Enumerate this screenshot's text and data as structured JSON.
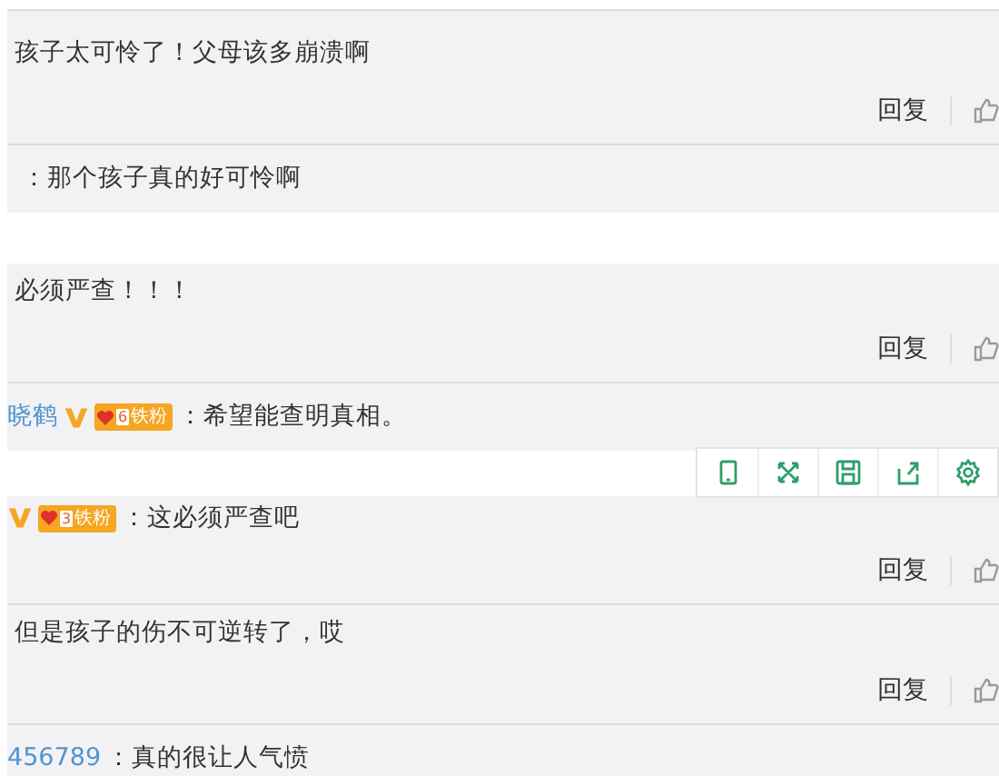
{
  "panels": [
    {
      "rows": [
        {
          "kind": "comment",
          "text": "孩子太可怜了！父母该多崩溃啊"
        },
        {
          "kind": "actions",
          "reply": "回复"
        },
        {
          "kind": "subcomment",
          "text": "：那个孩子真的好可怜啊"
        }
      ]
    },
    {
      "rows": [
        {
          "kind": "comment",
          "text": "必须严查！！！"
        },
        {
          "kind": "actions",
          "reply": "回复"
        },
        {
          "kind": "subcomment",
          "user": "晓鹤",
          "verified": true,
          "fan_badge": {
            "level": "6",
            "label": "铁粉"
          },
          "text": "：希望能查明真相。"
        }
      ],
      "toolbar_after": true
    },
    {
      "rows": [
        {
          "kind": "subcomment",
          "verified": true,
          "fan_badge": {
            "level": "3",
            "label": "铁粉"
          },
          "text": "：这必须严查吧"
        },
        {
          "kind": "actions",
          "reply": "回复"
        },
        {
          "kind": "comment",
          "text": "但是孩子的伤不可逆转了，哎"
        },
        {
          "kind": "actions",
          "reply": "回复"
        },
        {
          "kind": "subcomment",
          "user": "456789",
          "text": "：真的很让人气愤"
        }
      ]
    }
  ]
}
